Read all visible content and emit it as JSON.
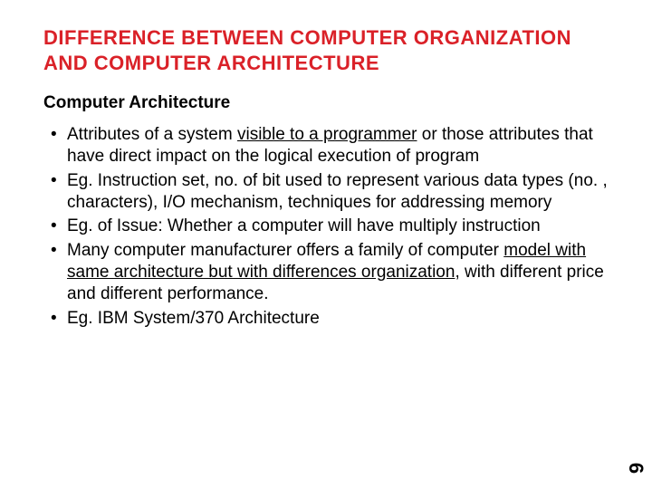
{
  "slide": {
    "title": "DIFFERENCE BETWEEN COMPUTER ORGANIZATION AND COMPUTER ARCHITECTURE",
    "subtitle": "Computer Architecture",
    "bullets": [
      {
        "pre": "Attributes of a system ",
        "u": "visible to a programmer",
        "post": " or those attributes that have direct impact on the logical execution of program"
      },
      {
        "pre": "Eg. Instruction set, no. of bit used to represent various data types (no. , characters), I/O mechanism, techniques for addressing memory",
        "u": "",
        "post": ""
      },
      {
        "pre": "Eg. of Issue: Whether a computer will have multiply instruction",
        "u": "",
        "post": ""
      },
      {
        "pre": "Many computer manufacturer offers a family of computer ",
        "u": "model with same architecture but with differences organization",
        "post": ", with different price and different performance."
      },
      {
        "pre": "Eg. IBM System/370 Architecture",
        "u": "",
        "post": ""
      }
    ],
    "page_number": "6"
  }
}
